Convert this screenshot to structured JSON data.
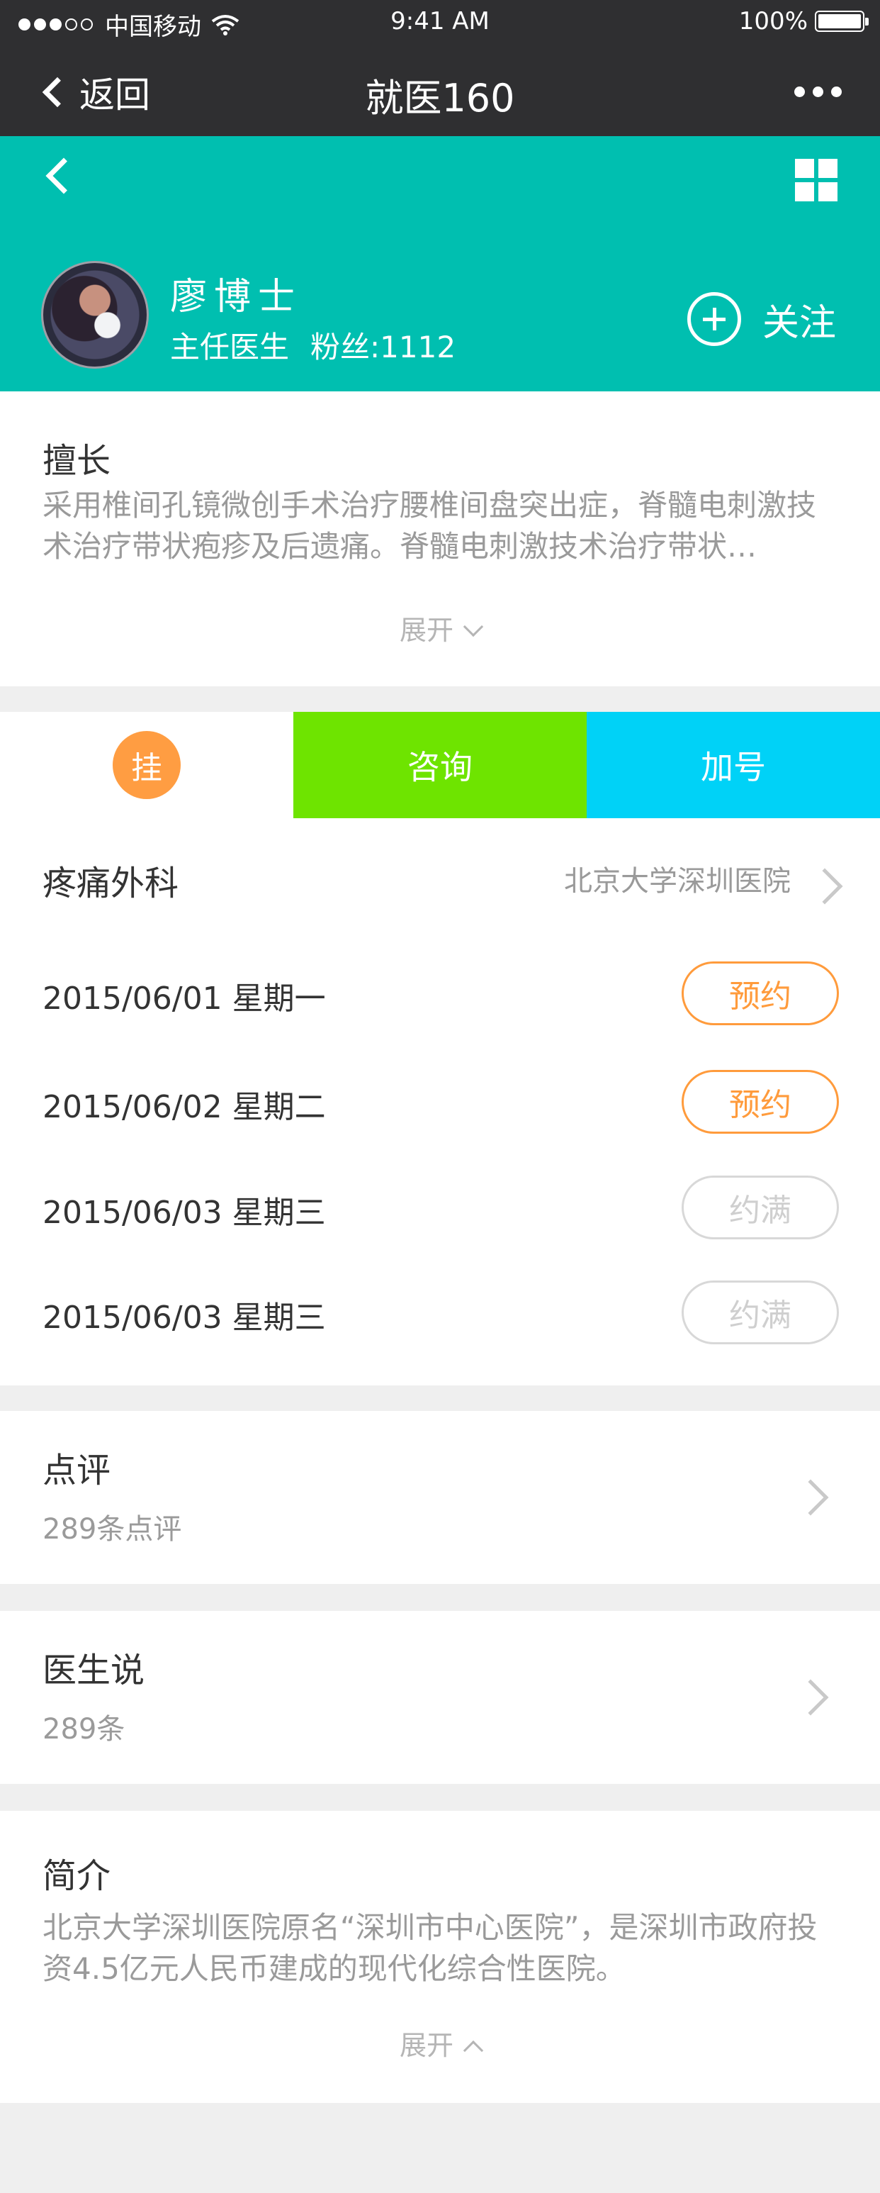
{
  "status_bar": {
    "carrier": "中国移动",
    "time": "9:41 AM",
    "battery": "100%",
    "battery_level": 1.0
  },
  "nav": {
    "back_label": "返回",
    "title": "就医160"
  },
  "doctor": {
    "name": "廖博士",
    "title": "主任医生",
    "fans": "粉丝:1112",
    "follow_label": "关注"
  },
  "expertise": {
    "title": "擅长",
    "description": "采用椎间孔镜微创手术治疗腰椎间盘突出症，脊髓电刺激技术治疗带状疱疹及后遗痛。脊髓电刺激技术治疗带状…",
    "expand_label": "展开"
  },
  "tabs": {
    "register_badge": "挂",
    "consult_label": "咨询",
    "add_label": "加号"
  },
  "schedule": {
    "department": "疼痛外科",
    "hospital": "北京大学深圳医院",
    "rows": [
      {
        "date": "2015/06/01 星期一",
        "status": "预约"
      },
      {
        "date": "2015/06/02 星期二",
        "status": "预约"
      },
      {
        "date": "2015/06/03 星期三",
        "status": "约满"
      },
      {
        "date": "2015/06/03 星期三",
        "status": "约满"
      }
    ]
  },
  "reviews": {
    "title": "点评",
    "count": "289条点评"
  },
  "doctor_says": {
    "title": "医生说",
    "count": "289条"
  },
  "intro": {
    "title": "简介",
    "description": "北京大学深圳医院原名“深圳市中心医院”，是深圳市政府投资4.5亿元人民币建成的现代化综合性医院。",
    "expand_label": "展开"
  },
  "colors": {
    "teal_header": "#00bfb0",
    "dark_bar": "#2f2f31",
    "orange_accent": "#ff9b3c",
    "green_tab": "#6ee400",
    "cyan_tab": "#00d2f7"
  }
}
